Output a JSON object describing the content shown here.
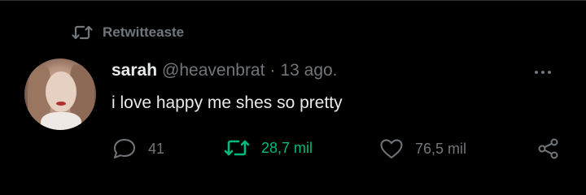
{
  "retweet_banner": {
    "label": "Retwitteaste",
    "icon": "retweet-icon",
    "color": "#71767b"
  },
  "tweet": {
    "author_name": "sarah",
    "author_handle": "@heavenbrat",
    "separator": "·",
    "date": "13 ago.",
    "text": "i love happy me shes so pretty"
  },
  "actions": {
    "reply": {
      "icon": "reply-icon",
      "count": "41"
    },
    "retweet": {
      "icon": "retweet-icon",
      "count": "28,7 mil",
      "active": true,
      "color": "#00ba7c"
    },
    "like": {
      "icon": "heart-icon",
      "count": "76,5 mil"
    },
    "share": {
      "icon": "share-icon"
    }
  },
  "colors": {
    "background": "#000000",
    "text": "#e7e9ea",
    "muted": "#71767b",
    "retweet_active": "#00ba7c"
  }
}
